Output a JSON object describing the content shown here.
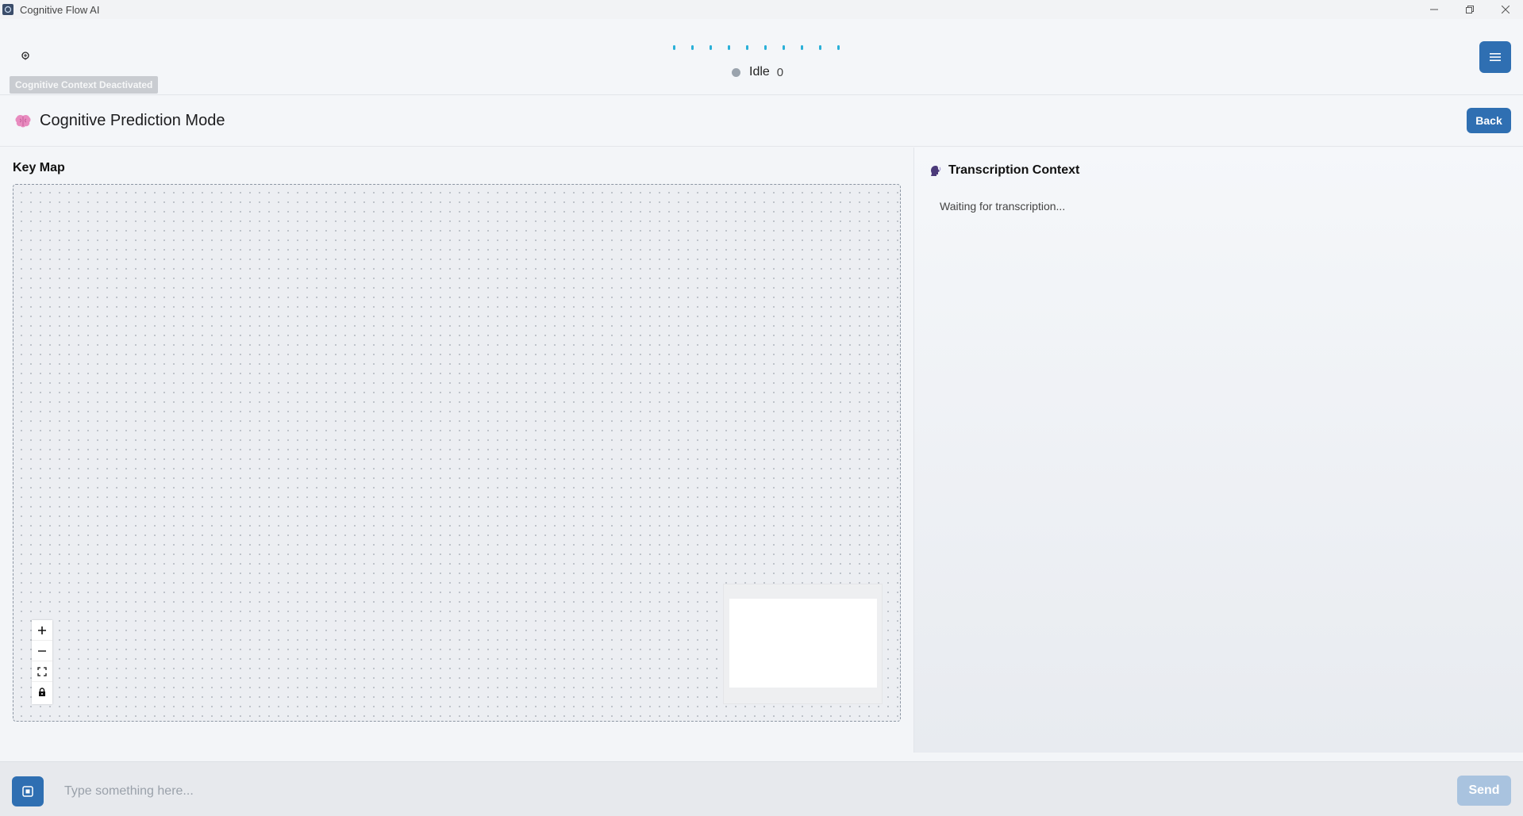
{
  "window": {
    "title": "Cognitive Flow AI",
    "icons": [
      "brain-icon",
      "minimize-icon",
      "restore-icon",
      "close-icon"
    ]
  },
  "header": {
    "context_badge": "Cognitive Context Deactivated",
    "status_label": "Idle",
    "status_count": "0",
    "status_color": "#9aa3ad",
    "wave_color": "#2ab0d8",
    "menu_icon": "hamburger-icon"
  },
  "page": {
    "title": "Cognitive Prediction Mode",
    "title_icon": "brain-icon",
    "back_label": "Back"
  },
  "keymap": {
    "title": "Key Map",
    "controls": [
      "zoom-in-icon",
      "zoom-out-icon",
      "fit-view-icon",
      "lock-icon"
    ]
  },
  "transcription": {
    "title": "Transcription Context",
    "title_icon": "speaking-head-icon",
    "waiting_text": "Waiting for transcription..."
  },
  "input_bar": {
    "placeholder": "Type something here...",
    "value": "",
    "send_label": "Send"
  },
  "colors": {
    "accent": "#2f6fb2",
    "send_disabled": "#a9c3df",
    "badge_bg": "#c9ccd1"
  }
}
